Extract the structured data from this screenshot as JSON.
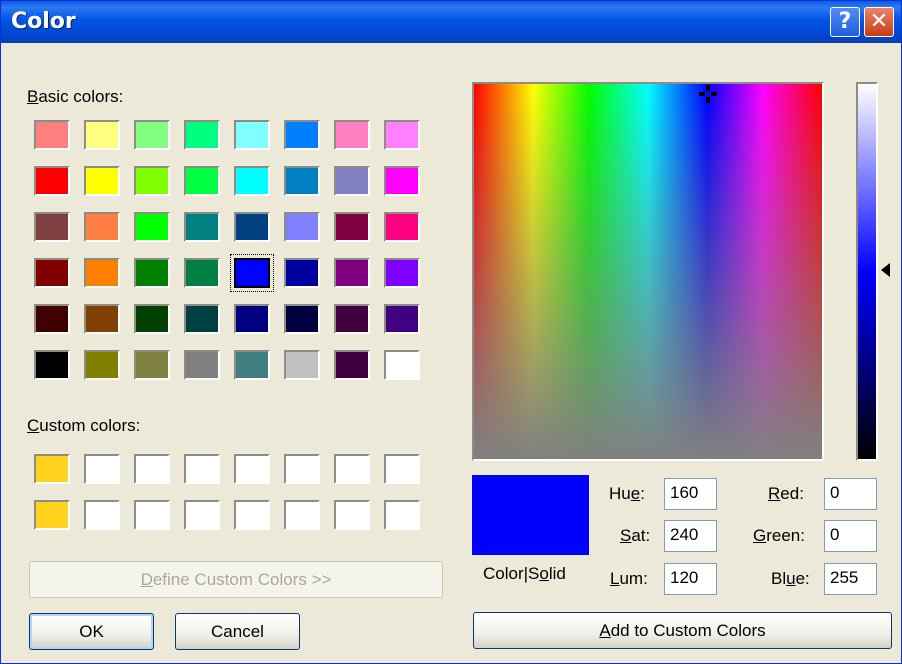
{
  "window": {
    "title": "Color"
  },
  "titlebar": {
    "help_label": "?",
    "close_label": "✕"
  },
  "basic": {
    "label_u": "B",
    "label_rest": "asic colors:"
  },
  "basic_colors": [
    [
      "#ff8080",
      "#ffff80",
      "#80ff80",
      "#00ff80",
      "#80ffff",
      "#0080ff",
      "#ff80c0",
      "#ff80ff"
    ],
    [
      "#ff0000",
      "#ffff00",
      "#80ff00",
      "#00ff40",
      "#00ffff",
      "#0080c0",
      "#8080c0",
      "#ff00ff"
    ],
    [
      "#804040",
      "#ff8040",
      "#00ff00",
      "#008080",
      "#004080",
      "#8080ff",
      "#800040",
      "#ff0080"
    ],
    [
      "#800000",
      "#ff8000",
      "#008000",
      "#008040",
      "#0000ff",
      "#0000a0",
      "#800080",
      "#8000ff"
    ],
    [
      "#400000",
      "#804000",
      "#004000",
      "#004040",
      "#000080",
      "#000040",
      "#400040",
      "#400080"
    ],
    [
      "#000000",
      "#808000",
      "#808040",
      "#808080",
      "#408080",
      "#c0c0c0",
      "#400040",
      "#ffffff"
    ]
  ],
  "selected_basic": {
    "row": 3,
    "col": 4
  },
  "custom": {
    "label_u": "C",
    "label_rest": "ustom colors:"
  },
  "custom_colors": [
    [
      "#ffd21e",
      "#ffffff",
      "#ffffff",
      "#ffffff",
      "#ffffff",
      "#ffffff",
      "#ffffff",
      "#ffffff"
    ],
    [
      "#ffd21e",
      "#ffffff",
      "#ffffff",
      "#ffffff",
      "#ffffff",
      "#ffffff",
      "#ffffff",
      "#ffffff"
    ]
  ],
  "buttons": {
    "define_u": "D",
    "define_rest": "efine Custom Colors >>",
    "ok": "OK",
    "cancel": "Cancel",
    "add_u": "A",
    "add_rest": "dd to Custom Colors"
  },
  "colorsolid": {
    "pre": "Color|S",
    "u": "o",
    "post": "lid"
  },
  "hsl": {
    "hue_pre": "Hu",
    "hue_u": "e",
    "hue_post": ":",
    "hue_value": "160",
    "sat_u": "S",
    "sat_post": "at:",
    "sat_value": "240",
    "lum_u": "L",
    "lum_post": "um:",
    "lum_value": "120"
  },
  "rgb": {
    "red_u": "R",
    "red_post": "ed:",
    "red_value": "0",
    "green_u": "G",
    "green_post": "reen:",
    "green_value": "0",
    "blue_pre": "Bl",
    "blue_u": "u",
    "blue_post": "e:",
    "blue_value": "255"
  },
  "current_color": "#0000ff"
}
